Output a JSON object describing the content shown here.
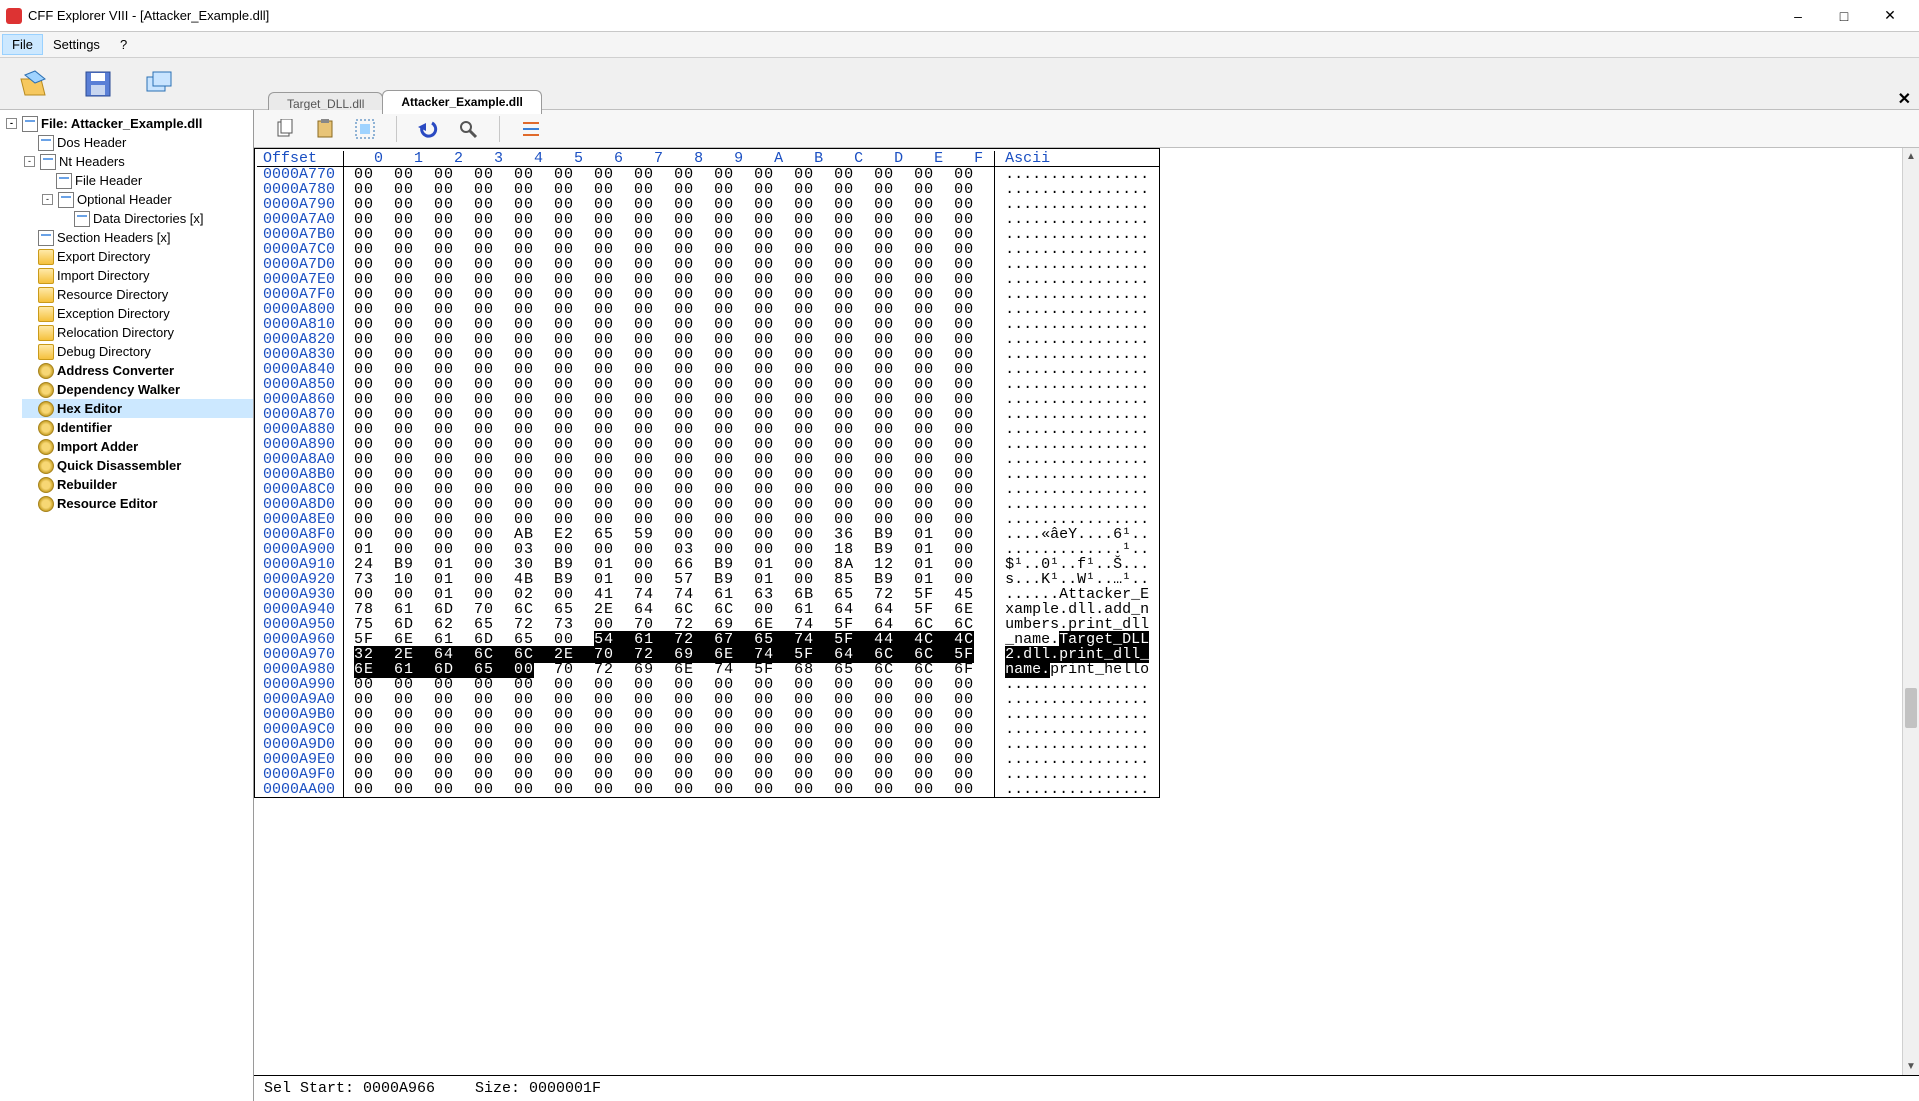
{
  "window": {
    "title": "CFF Explorer VIII - [Attacker_Example.dll]"
  },
  "menu": {
    "file": "File",
    "settings": "Settings",
    "help": "?"
  },
  "tabs": {
    "inactive": "Target_DLL.dll",
    "active": "Attacker_Example.dll"
  },
  "tree": {
    "root": "File: Attacker_Example.dll",
    "dos": "Dos Header",
    "nt": "Nt Headers",
    "fileh": "File Header",
    "opth": "Optional Header",
    "datadir": "Data Directories [x]",
    "sect": "Section Headers [x]",
    "exp": "Export Directory",
    "imp": "Import Directory",
    "res": "Resource Directory",
    "exc": "Exception Directory",
    "reloc": "Relocation Directory",
    "dbg": "Debug Directory",
    "addr": "Address Converter",
    "dep": "Dependency Walker",
    "hex": "Hex Editor",
    "ident": "Identifier",
    "impa": "Import Adder",
    "qdis": "Quick Disassembler",
    "reb": "Rebuilder",
    "rese": "Resource Editor"
  },
  "hex_header": {
    "offset": "Offset",
    "cols": "  0   1   2   3   4   5   6   7   8   9   A   B   C   D   E   F",
    "ascii": "Ascii"
  },
  "hex_rows": [
    {
      "o": "0000A770",
      "h": "00  00  00  00  00  00  00  00  00  00  00  00  00  00  00  00",
      "a": "................"
    },
    {
      "o": "0000A780",
      "h": "00  00  00  00  00  00  00  00  00  00  00  00  00  00  00  00",
      "a": "................"
    },
    {
      "o": "0000A790",
      "h": "00  00  00  00  00  00  00  00  00  00  00  00  00  00  00  00",
      "a": "................"
    },
    {
      "o": "0000A7A0",
      "h": "00  00  00  00  00  00  00  00  00  00  00  00  00  00  00  00",
      "a": "................"
    },
    {
      "o": "0000A7B0",
      "h": "00  00  00  00  00  00  00  00  00  00  00  00  00  00  00  00",
      "a": "................"
    },
    {
      "o": "0000A7C0",
      "h": "00  00  00  00  00  00  00  00  00  00  00  00  00  00  00  00",
      "a": "................"
    },
    {
      "o": "0000A7D0",
      "h": "00  00  00  00  00  00  00  00  00  00  00  00  00  00  00  00",
      "a": "................"
    },
    {
      "o": "0000A7E0",
      "h": "00  00  00  00  00  00  00  00  00  00  00  00  00  00  00  00",
      "a": "................"
    },
    {
      "o": "0000A7F0",
      "h": "00  00  00  00  00  00  00  00  00  00  00  00  00  00  00  00",
      "a": "................"
    },
    {
      "o": "0000A800",
      "h": "00  00  00  00  00  00  00  00  00  00  00  00  00  00  00  00",
      "a": "................"
    },
    {
      "o": "0000A810",
      "h": "00  00  00  00  00  00  00  00  00  00  00  00  00  00  00  00",
      "a": "................"
    },
    {
      "o": "0000A820",
      "h": "00  00  00  00  00  00  00  00  00  00  00  00  00  00  00  00",
      "a": "................"
    },
    {
      "o": "0000A830",
      "h": "00  00  00  00  00  00  00  00  00  00  00  00  00  00  00  00",
      "a": "................"
    },
    {
      "o": "0000A840",
      "h": "00  00  00  00  00  00  00  00  00  00  00  00  00  00  00  00",
      "a": "................"
    },
    {
      "o": "0000A850",
      "h": "00  00  00  00  00  00  00  00  00  00  00  00  00  00  00  00",
      "a": "................"
    },
    {
      "o": "0000A860",
      "h": "00  00  00  00  00  00  00  00  00  00  00  00  00  00  00  00",
      "a": "................"
    },
    {
      "o": "0000A870",
      "h": "00  00  00  00  00  00  00  00  00  00  00  00  00  00  00  00",
      "a": "................"
    },
    {
      "o": "0000A880",
      "h": "00  00  00  00  00  00  00  00  00  00  00  00  00  00  00  00",
      "a": "................"
    },
    {
      "o": "0000A890",
      "h": "00  00  00  00  00  00  00  00  00  00  00  00  00  00  00  00",
      "a": "................"
    },
    {
      "o": "0000A8A0",
      "h": "00  00  00  00  00  00  00  00  00  00  00  00  00  00  00  00",
      "a": "................"
    },
    {
      "o": "0000A8B0",
      "h": "00  00  00  00  00  00  00  00  00  00  00  00  00  00  00  00",
      "a": "................"
    },
    {
      "o": "0000A8C0",
      "h": "00  00  00  00  00  00  00  00  00  00  00  00  00  00  00  00",
      "a": "................"
    },
    {
      "o": "0000A8D0",
      "h": "00  00  00  00  00  00  00  00  00  00  00  00  00  00  00  00",
      "a": "................"
    },
    {
      "o": "0000A8E0",
      "h": "00  00  00  00  00  00  00  00  00  00  00  00  00  00  00  00",
      "a": "................"
    },
    {
      "o": "0000A8F0",
      "h": "00  00  00  00  AB  E2  65  59  00  00  00  00  36  B9  01  00",
      "a": "....«âeY....6¹.."
    },
    {
      "o": "0000A900",
      "h": "01  00  00  00  03  00  00  00  03  00  00  00  18  B9  01  00",
      "a": ".............¹.."
    },
    {
      "o": "0000A910",
      "h": "24  B9  01  00  30  B9  01  00  66  B9  01  00  8A  12  01  00",
      "a": "$¹..0¹..f¹..Š..."
    },
    {
      "o": "0000A920",
      "h": "73  10  01  00  4B  B9  01  00  57  B9  01  00  85  B9  01  00",
      "a": "s...K¹..W¹..…¹.."
    },
    {
      "o": "0000A930",
      "h": "00  00  01  00  02  00  41  74  74  61  63  6B  65  72  5F  45",
      "a": "......Attacker_E"
    },
    {
      "o": "0000A940",
      "h": "78  61  6D  70  6C  65  2E  64  6C  6C  00  61  64  64  5F  6E",
      "a": "xample.dll.add_n"
    },
    {
      "o": "0000A950",
      "h": "75  6D  62  65  72  73  00  70  72  69  6E  74  5F  64  6C  6C",
      "a": "umbers.print_dll"
    },
    {
      "o": "0000A990",
      "h": "00  00  00  00  00  00  00  00  00  00  00  00  00  00  00  00",
      "a": "................"
    },
    {
      "o": "0000A9A0",
      "h": "00  00  00  00  00  00  00  00  00  00  00  00  00  00  00  00",
      "a": "................"
    },
    {
      "o": "0000A9B0",
      "h": "00  00  00  00  00  00  00  00  00  00  00  00  00  00  00  00",
      "a": "................"
    },
    {
      "o": "0000A9C0",
      "h": "00  00  00  00  00  00  00  00  00  00  00  00  00  00  00  00",
      "a": "................"
    },
    {
      "o": "0000A9D0",
      "h": "00  00  00  00  00  00  00  00  00  00  00  00  00  00  00  00",
      "a": "................"
    },
    {
      "o": "0000A9E0",
      "h": "00  00  00  00  00  00  00  00  00  00  00  00  00  00  00  00",
      "a": "................"
    },
    {
      "o": "0000A9F0",
      "h": "00  00  00  00  00  00  00  00  00  00  00  00  00  00  00  00",
      "a": "................"
    },
    {
      "o": "0000AA00",
      "h": "00  00  00  00  00  00  00  00  00  00  00  00  00  00  00  00",
      "a": "................"
    }
  ],
  "hex_sel_rows": {
    "r960": {
      "o": "0000A960",
      "h_pre": "5F  6E  61  6D  65  00  ",
      "h_sel": "54  61  72  67  65  74  5F  44  4C  4C",
      "h_post": "",
      "a_pre": "_name.",
      "a_sel": "Target_DLL",
      "a_post": ""
    },
    "r970": {
      "o": "0000A970",
      "h_pre": "",
      "h_sel": "32  2E  64  6C  6C  2E  70  72  69  6E  74  5F  64  6C  6C  5F",
      "h_post": "",
      "a_pre": "",
      "a_sel": "2.dll.print_dll_",
      "a_post": ""
    },
    "r980": {
      "o": "0000A980",
      "h_pre": "",
      "h_sel": "6E  61  6D  65  00",
      "h_post": "  70  72  69  6E  74  5F  68  65  6C  6C  6F",
      "a_pre": "",
      "a_sel": "name.",
      "a_post": "print_hello"
    }
  },
  "status": {
    "sel": "Sel Start: 0000A966",
    "size": "Size: 0000001F"
  }
}
